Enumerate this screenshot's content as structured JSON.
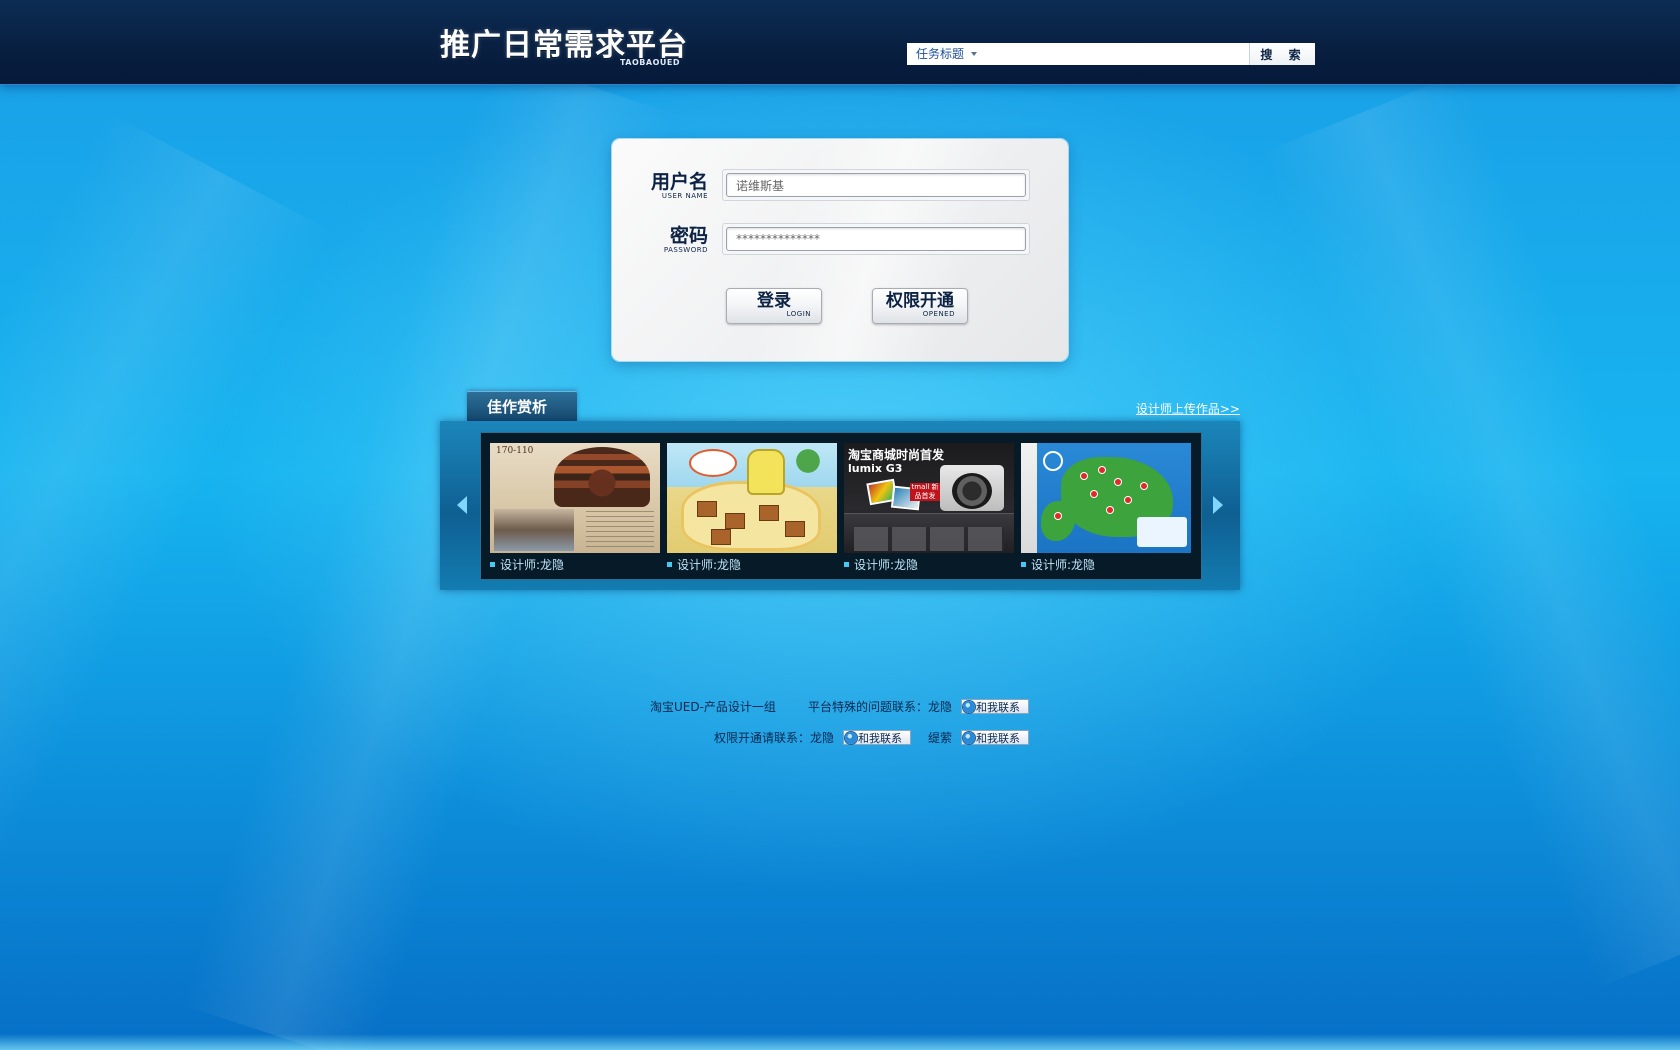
{
  "header": {
    "logo_title": "推广日常需求平台",
    "logo_subtitle": "TAOBAOUED",
    "search": {
      "category": "任务标题",
      "input_value": "",
      "button_label": "搜 索"
    }
  },
  "login": {
    "username_label": "用户名",
    "username_label_en": "USER NAME",
    "username_value": "诺维斯基",
    "password_label": "密码",
    "password_label_en": "PASSWORD",
    "password_value": "**************",
    "login_button": "登录",
    "login_button_en": "LOGIN",
    "open_button": "权限开通",
    "open_button_en": "OPENED"
  },
  "gallery": {
    "tab_label": "佳作赏析",
    "upload_link": "设计师上传作品>>",
    "items": [
      {
        "caption": "设计师:龙隐"
      },
      {
        "caption": "设计师:龙隐"
      },
      {
        "caption": "设计师:龙隐"
      },
      {
        "caption": "设计师:龙隐"
      }
    ],
    "thumb1": {
      "header_text": "170-110"
    },
    "thumb3": {
      "title": "淘宝商城时尚首发",
      "subtitle": "lumix G3",
      "badge": "tmall 新品首发"
    }
  },
  "footer": {
    "team": "淘宝UED-产品设计一组",
    "issue_contact": "平台特殊的问题联系：龙隐",
    "permission_contact": "权限开通请联系：龙隐",
    "other_contact": "缇萦",
    "contact_button": "和我联系"
  },
  "colors": {
    "header_bg": "#081f40",
    "page_bg": "#17b4f0",
    "gallery_bg": "#0f5f92",
    "text_dark": "#0b2850",
    "link_white": "#ffffff"
  }
}
